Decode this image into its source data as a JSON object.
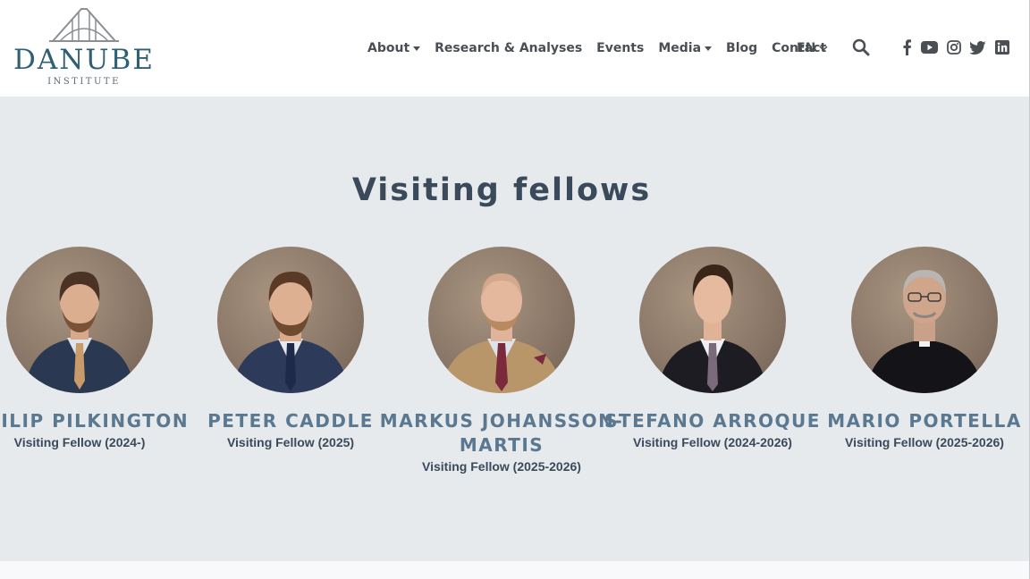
{
  "logo": {
    "name": "DANUBE",
    "subtitle": "INSTITUTE"
  },
  "nav": {
    "items": [
      {
        "label": "About",
        "dropdown": true
      },
      {
        "label": "Research & Analyses",
        "dropdown": false
      },
      {
        "label": "Events",
        "dropdown": false
      },
      {
        "label": "Media",
        "dropdown": true
      },
      {
        "label": "Blog",
        "dropdown": false
      },
      {
        "label": "Contact",
        "dropdown": false
      }
    ],
    "language": "EN",
    "icons": [
      "search-icon",
      "facebook-icon",
      "youtube-icon",
      "instagram-icon",
      "twitter-icon",
      "linkedin-icon"
    ]
  },
  "main": {
    "title": "Visiting fellows",
    "fellows": [
      {
        "name": "PHILIP PILKINGTON",
        "role": "Visiting Fellow (2024-)"
      },
      {
        "name": "PETER CADDLE",
        "role": "Visiting Fellow (2025)"
      },
      {
        "name": "MARKUS JOHANSSON-MARTIS",
        "role": "Visiting Fellow (2025-2026)"
      },
      {
        "name": "STEFANO ARROQUE",
        "role": "Visiting Fellow (2024-2026)"
      },
      {
        "name": "MARIO PORTELLA",
        "role": "Visiting Fellow (2025-2026)"
      }
    ]
  },
  "colors": {
    "brand": "#2f5f74",
    "name_link": "#5a7890",
    "section_bg": "#e7eaed",
    "text": "#3a4a5a"
  }
}
